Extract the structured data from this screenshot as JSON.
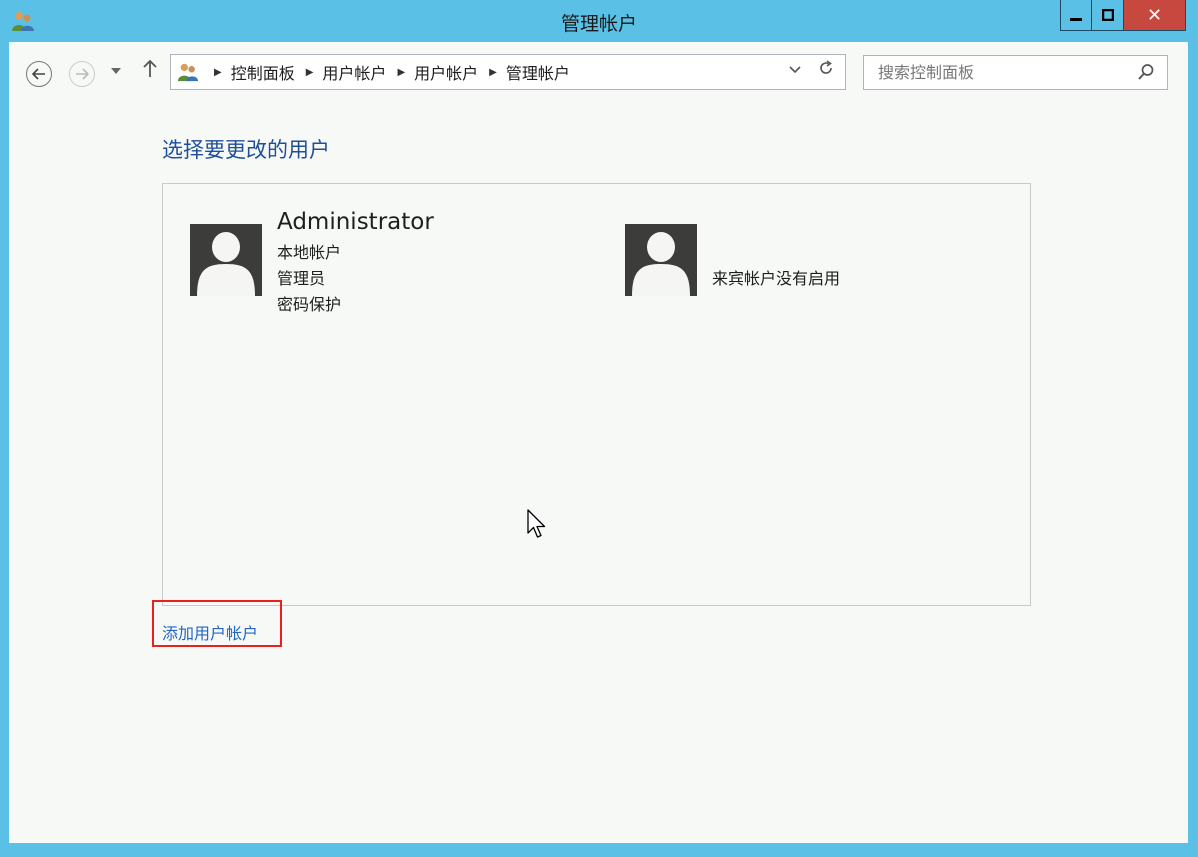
{
  "window": {
    "title": "管理帐户",
    "controls": {
      "minimize": "minimize-icon",
      "maximize": "maximize-icon",
      "close": "✕"
    }
  },
  "navigation": {
    "icons": [
      "back-arrow-icon",
      "forward-arrow-icon",
      "recent-pages-icon",
      "up-arrow-icon"
    ],
    "breadcrumb": [
      "控制面板",
      "用户帐户",
      "用户帐户",
      "管理帐户"
    ],
    "search_placeholder": "搜索控制面板"
  },
  "main": {
    "heading": "选择要更改的用户",
    "accounts": [
      {
        "name": "Administrator",
        "details": [
          "本地帐户",
          "管理员",
          "密码保护"
        ]
      },
      {
        "name": "",
        "details": [
          "来宾帐户没有启用"
        ]
      }
    ],
    "add_account_link": "添加用户帐户"
  },
  "colors": {
    "frame": "#5bc0e6",
    "close_button": "#c7483f",
    "heading": "#1f4e9c",
    "link": "#2466c6",
    "highlight_box": "#e8201f",
    "avatar_bg": "#3c3c3a"
  }
}
